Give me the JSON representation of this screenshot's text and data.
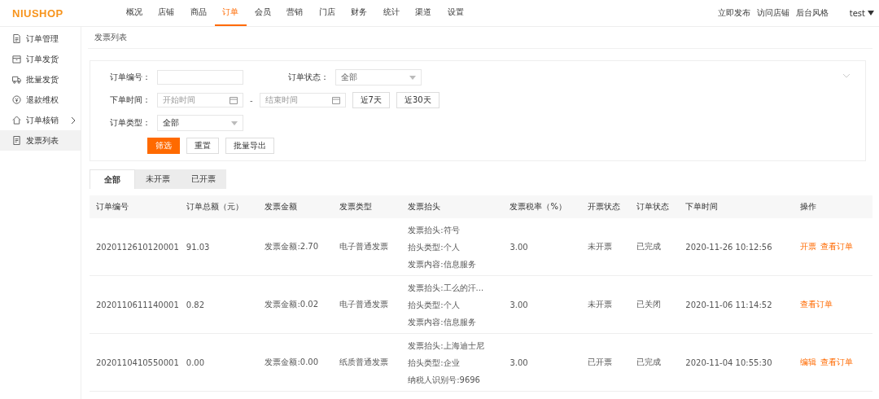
{
  "logo": "NIUSHOP",
  "nav": [
    {
      "label": "概况",
      "selected": false
    },
    {
      "label": "店铺",
      "selected": false
    },
    {
      "label": "商品",
      "selected": false
    },
    {
      "label": "订单",
      "selected": true
    },
    {
      "label": "会员",
      "selected": false
    },
    {
      "label": "营销",
      "selected": false
    },
    {
      "label": "门店",
      "selected": false
    },
    {
      "label": "财务",
      "selected": false
    },
    {
      "label": "统计",
      "selected": false
    },
    {
      "label": "渠道",
      "selected": false
    },
    {
      "label": "设置",
      "selected": false
    }
  ],
  "top_links": [
    "立即发布",
    "访问店铺",
    "后台风格"
  ],
  "user": "test",
  "sidebar": [
    {
      "label": "订单管理",
      "selected": false,
      "has_submenu": false
    },
    {
      "label": "订单发货",
      "selected": false,
      "has_submenu": false
    },
    {
      "label": "批量发货",
      "selected": false,
      "has_submenu": false
    },
    {
      "label": "退款维权",
      "selected": false,
      "has_submenu": false
    },
    {
      "label": "订单核销",
      "selected": false,
      "has_submenu": true
    },
    {
      "label": "发票列表",
      "selected": true,
      "has_submenu": false
    }
  ],
  "breadcrumb": "发票列表",
  "filter": {
    "order_no": {
      "label": "订单编号："
    },
    "order_status": {
      "label": "订单状态：",
      "value": "全部"
    },
    "order_time": {
      "label": "下单时间：",
      "start_placeholder": "开始时间",
      "separator": "-",
      "end_placeholder": "结束时间",
      "quick": [
        "近7天",
        "近30天"
      ]
    },
    "order_type": {
      "label": "订单类型：",
      "value": "全部"
    },
    "buttons": [
      {
        "label": "筛选",
        "kind": "primary"
      },
      {
        "label": "重置",
        "kind": "default"
      },
      {
        "label": "批量导出",
        "kind": "default"
      }
    ]
  },
  "tabs": [
    {
      "label": "全部",
      "selected": true
    },
    {
      "label": "未开票",
      "selected": false
    },
    {
      "label": "已开票",
      "selected": false
    }
  ],
  "table": {
    "columns": [
      "订单编号",
      "订单总额（元）",
      "发票金额",
      "发票类型",
      "发票抬头",
      "发票税率（%）",
      "开票状态",
      "订单状态",
      "下单时间",
      "操作"
    ],
    "rows": [
      {
        "order_no": "2020112610120001",
        "total": "91.03",
        "amount": "发票金额:2.70",
        "type": "电子普通发票",
        "header": [
          "发票抬头:符号",
          "抬头类型:个人",
          "发票内容:信息服务"
        ],
        "rate": "3.00",
        "invoice_status": "未开票",
        "order_status": "已完成",
        "time": "2020-11-26 10:12:56",
        "actions": [
          "开票",
          "查看订单"
        ]
      },
      {
        "order_no": "2020110611140001",
        "total": "0.82",
        "amount": "发票金额:0.02",
        "type": "电子普通发票",
        "header": [
          "发票抬头:工么的汗...",
          "抬头类型:个人",
          "发票内容:信息服务"
        ],
        "rate": "3.00",
        "invoice_status": "未开票",
        "order_status": "已关闭",
        "time": "2020-11-06 11:14:52",
        "actions": [
          "查看订单"
        ]
      },
      {
        "order_no": "2020110410550001",
        "total": "0.00",
        "amount": "发票金额:0.00",
        "type": "纸质普通发票",
        "header": [
          "发票抬头:上海迪士尼",
          "抬头类型:企业",
          "纳税人识别号:9696"
        ],
        "rate": "3.00",
        "invoice_status": "已开票",
        "order_status": "已完成",
        "time": "2020-11-04 10:55:30",
        "actions": [
          "编辑",
          "查看订单"
        ]
      }
    ]
  }
}
